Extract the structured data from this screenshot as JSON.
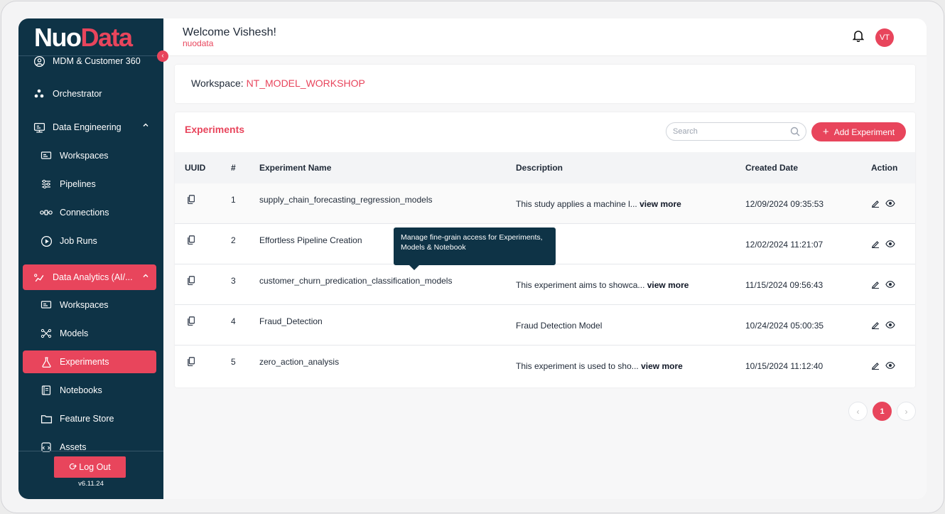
{
  "brand": {
    "part1": "Nuo",
    "part2": "Data"
  },
  "sidebar": {
    "items": [
      {
        "label": "MDM & Customer 360"
      },
      {
        "label": "Orchestrator"
      },
      {
        "label": "Data Engineering"
      },
      {
        "label": "Workspaces"
      },
      {
        "label": "Pipelines"
      },
      {
        "label": "Connections"
      },
      {
        "label": "Job Runs"
      },
      {
        "label": "Data Analytics (AI/..."
      },
      {
        "label": "Workspaces"
      },
      {
        "label": "Models"
      },
      {
        "label": "Experiments"
      },
      {
        "label": "Notebooks"
      },
      {
        "label": "Feature Store"
      },
      {
        "label": "Assets"
      }
    ],
    "logout_label": "Log Out",
    "version": "v6.11.24"
  },
  "header": {
    "welcome": "Welcome Vishesh!",
    "tenant": "nuodata",
    "avatar_initials": "VT"
  },
  "workspace": {
    "label": "Workspace:",
    "value": "NT_MODEL_WORKSHOP"
  },
  "experiments": {
    "title": "Experiments",
    "search_placeholder": "Search",
    "add_button": "Add Experiment",
    "columns": [
      "UUID",
      "#",
      "Experiment Name",
      "Description",
      "Created Date",
      "Action"
    ],
    "rows": [
      {
        "num": "1",
        "name": "supply_chain_forecasting_regression_models",
        "desc": "This study applies a machine l...",
        "more": "view more",
        "date": "12/09/2024 09:35:53"
      },
      {
        "num": "2",
        "name": "Effortless Pipeline Creation",
        "desc": "",
        "more": "",
        "date": "12/02/2024 11:21:07"
      },
      {
        "num": "3",
        "name": "customer_churn_predication_classification_models",
        "desc": "This experiment aims to showca...",
        "more": "view more",
        "date": "11/15/2024 09:56:43"
      },
      {
        "num": "4",
        "name": "Fraud_Detection",
        "desc": "Fraud Detection Model",
        "more": "",
        "date": "10/24/2024 05:00:35"
      },
      {
        "num": "5",
        "name": "zero_action_analysis",
        "desc": "This experiment is used to sho...",
        "more": "view more",
        "date": "10/15/2024 11:12:40"
      }
    ],
    "tooltip": "Manage  fine-grain access for Experiments, Models & Notebook"
  },
  "pagination": {
    "current": "1",
    "prev": "‹",
    "next": "›"
  },
  "colors": {
    "accent": "#e8455c",
    "sidebar": "#0e3346"
  }
}
